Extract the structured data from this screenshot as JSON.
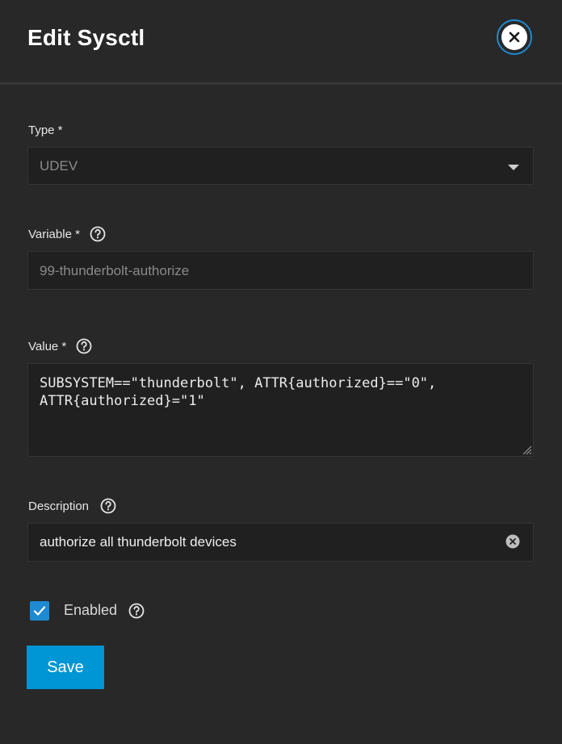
{
  "dialog": {
    "title": "Edit Sysctl",
    "close_icon": "close-icon"
  },
  "type": {
    "label": "Type *",
    "value": "UDEV"
  },
  "variable": {
    "label": "Variable *",
    "value": "99-thunderbolt-authorize"
  },
  "value": {
    "label": "Value *",
    "line1": "SUBSYSTEM==\"thunderbolt\", ATTR{authorized}==\"0\",",
    "line2": "ATTR{authorized}=\"1\""
  },
  "description": {
    "label": "Description",
    "value": "authorize all thunderbolt devices"
  },
  "enabled": {
    "label": "Enabled",
    "checked": true
  },
  "save": {
    "label": "Save"
  },
  "colors": {
    "background": "#282828",
    "field_bg": "#202020",
    "accent": "#0095d5",
    "checkbox": "#1e8ad1"
  }
}
